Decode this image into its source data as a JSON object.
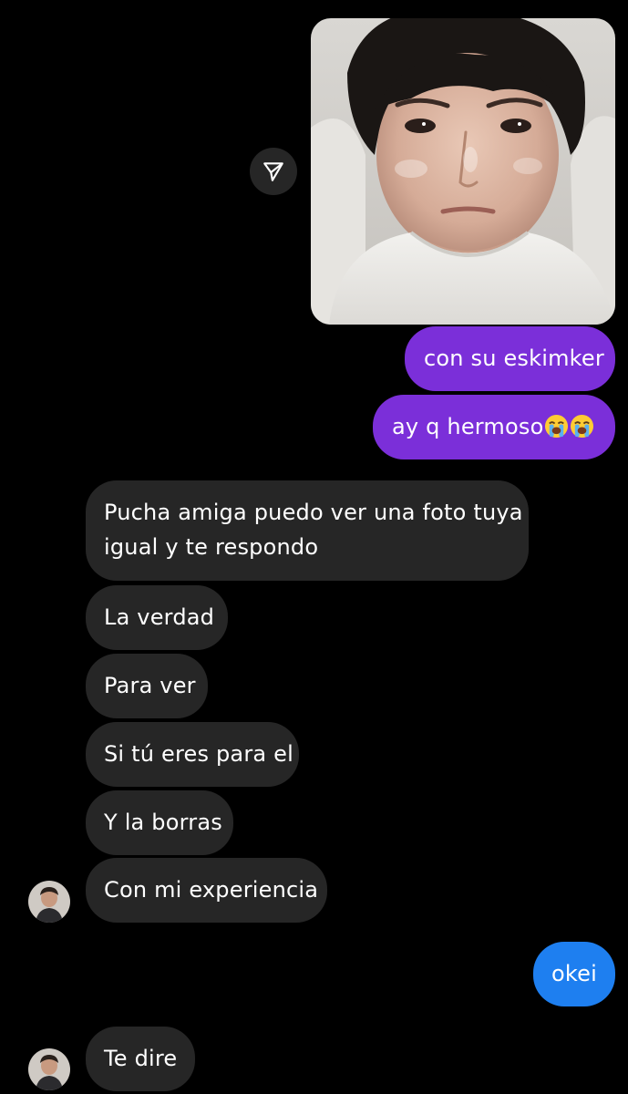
{
  "chat": {
    "share_icon": "paper-plane-icon",
    "sent_photo": "selfie-photo",
    "sent": [
      {
        "text": "con su eskimker"
      },
      {
        "text": "ay q hermoso",
        "emojis": [
          "loudly-crying-face-emoji",
          "loudly-crying-face-emoji"
        ]
      },
      {
        "text": "okei"
      }
    ],
    "received": [
      {
        "line1": "Pucha amiga puedo ver una foto tuya",
        "line2": "igual y te respondo"
      },
      {
        "text": "La verdad"
      },
      {
        "text": "Para ver"
      },
      {
        "text": "Si tú eres para el"
      },
      {
        "text": "Y la borras"
      },
      {
        "text": "Con mi experiencia"
      },
      {
        "text": "Te dire"
      }
    ]
  },
  "colors": {
    "background": "#000000",
    "sent_purple": "#7b2fd9",
    "sent_blue": "#1e7ff0",
    "received_gray": "#262626",
    "text": "#ffffff"
  }
}
